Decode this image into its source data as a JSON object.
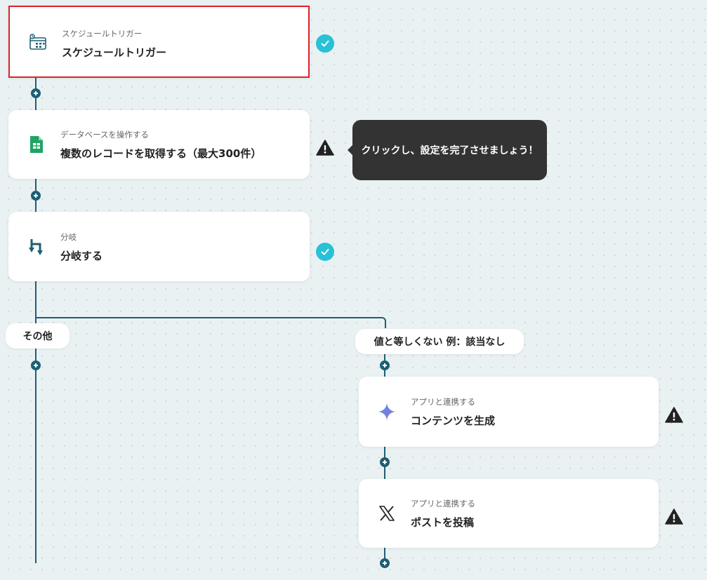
{
  "nodes": {
    "schedule": {
      "subtitle": "スケジュールトリガー",
      "title": "スケジュールトリガー",
      "status": "complete"
    },
    "database": {
      "subtitle": "データベースを操作する",
      "title": "複数のレコードを取得する（最大300件）",
      "status": "warning"
    },
    "branch": {
      "subtitle": "分岐",
      "title": "分岐する",
      "status": "complete"
    },
    "generate": {
      "subtitle": "アプリと連携する",
      "title": "コンテンツを生成",
      "status": "warning"
    },
    "post": {
      "subtitle": "アプリと連携する",
      "title": "ポストを投稿",
      "status": "warning"
    }
  },
  "tooltip": {
    "text": "クリックし、設定を完了させましょう！"
  },
  "branches": {
    "left_label": "その他",
    "right_label": "値と等しくない 例：該当なし"
  },
  "icons": {
    "schedule": "calendar-clock-icon",
    "database": "google-sheets-icon",
    "branch": "branch-icon",
    "generate": "gemini-sparkle-icon",
    "post": "x-logo-icon",
    "complete": "check-circle-icon",
    "warning": "warning-triangle-icon"
  },
  "colors": {
    "connector": "#1d5f73",
    "check": "#28c1d6",
    "selected_border": "#e0222a",
    "tooltip_bg": "#333333"
  }
}
